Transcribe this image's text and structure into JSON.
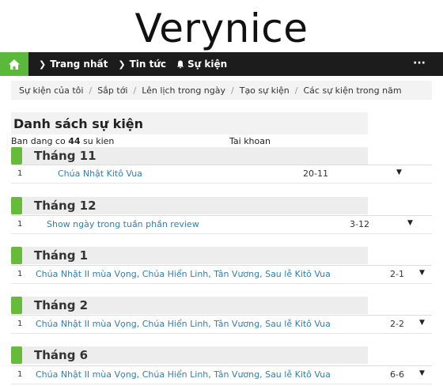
{
  "logo": "Verynice",
  "nav": {
    "items": [
      "Trang nhất",
      "Tin tức",
      "Sự kiện"
    ],
    "more": "···"
  },
  "breadcrumb": [
    "Sự kiện của tôi",
    "Sắp tới",
    "Lên lịch trong ngày",
    "Tạo sự kiện",
    "Các sự kiện trong năm"
  ],
  "list": {
    "title": "Danh sách sự kiện",
    "count_prefix": "Ban dang co",
    "count": "44",
    "count_suffix": "su kien",
    "col_header": "Tai khoan"
  },
  "groups": [
    {
      "month": "Tháng 11",
      "row": {
        "num": "1",
        "event": "Chúa Nhật Kitô Vua",
        "date": "20-11"
      }
    },
    {
      "month": "Tháng 12",
      "row": {
        "num": "1",
        "event": "Show ngày trong tuần phần review",
        "date": "3-12"
      }
    },
    {
      "month": "Tháng 1",
      "row": {
        "num": "1",
        "event": "Chúa Nhật II mùa Vọng, Chúa Hiển Linh, Tân Vương, Sau lễ Kitô Vua",
        "date": "2-1"
      }
    },
    {
      "month": "Tháng 2",
      "row": {
        "num": "1",
        "event": "Chúa Nhật II mùa Vọng, Chúa Hiển Linh, Tân Vương, Sau lễ Kitô Vua",
        "date": "2-2"
      }
    },
    {
      "month": "Tháng 6",
      "row": {
        "num": "1",
        "event": "Chúa Nhật II mùa Vọng, Chúa Hiển Linh, Tân Vương, Sau lễ Kitô Vua",
        "date": "6-6"
      }
    }
  ],
  "colors": {
    "accent": "#66bb3b",
    "nav_bg": "#1c1c1c",
    "link": "#2f7fb5"
  },
  "icons": {
    "home": "home-icon",
    "bell": "bell-icon",
    "caret": "caret-down-icon"
  }
}
